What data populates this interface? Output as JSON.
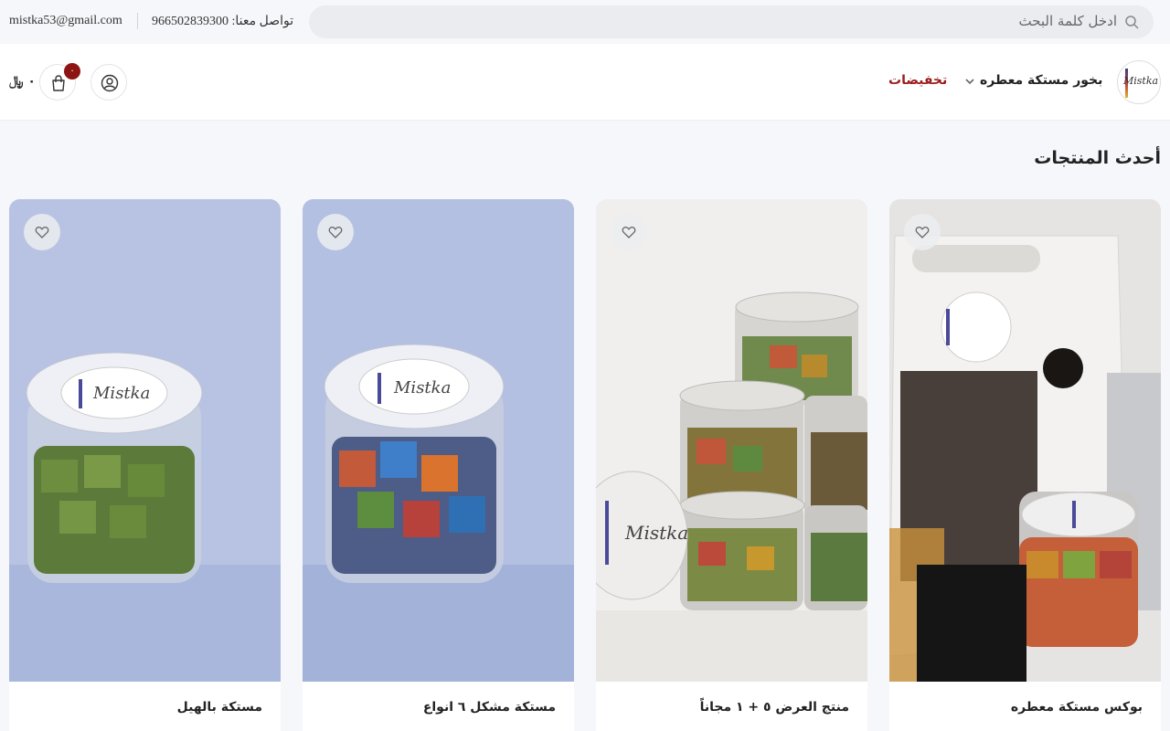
{
  "topbar": {
    "search_placeholder": "ادخل كلمة البحث",
    "contact": "تواصل معنا: 966502839300",
    "email": "mistka53@gmail.com"
  },
  "header": {
    "logo_text": "Mistka",
    "nav": [
      {
        "label": "بخور مستكة معطره",
        "has_dropdown": true
      },
      {
        "label": "تخفيضات",
        "color": "#9b1b1b"
      }
    ],
    "cart_count": "٠",
    "cart_total": "٠ ﷼"
  },
  "section": {
    "title": "أحدث المنتجات"
  },
  "products": [
    {
      "name": "بوكس مستكة معطره",
      "image_style": "box"
    },
    {
      "name": "منتج العرض ٥ + ١ مجاناً",
      "image_style": "stack"
    },
    {
      "name": "مستكة مشكل ٦ انواع",
      "image_style": "mixed"
    },
    {
      "name": "مستكة بالهيل",
      "image_style": "green"
    }
  ],
  "jar_label": "Mistka",
  "colors": {
    "accent": "#9b1b1b",
    "badge": "#8e1414",
    "page_bg": "#f6f7fa"
  }
}
